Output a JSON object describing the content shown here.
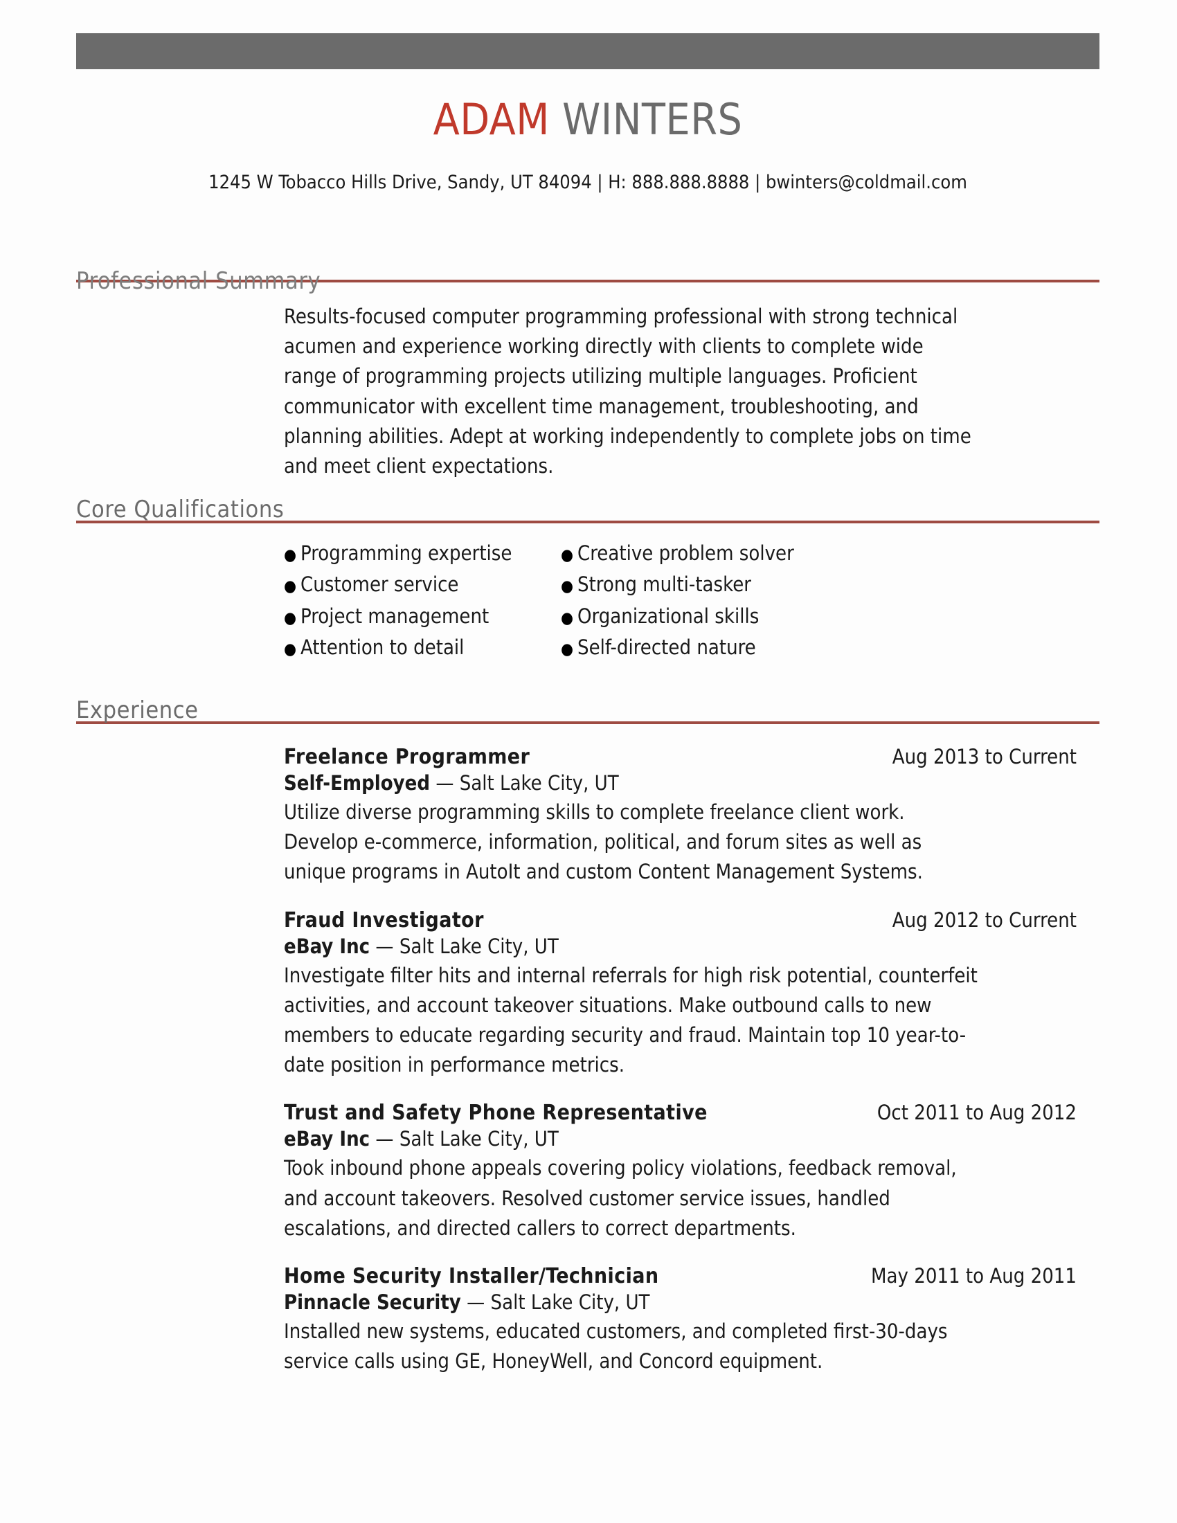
{
  "theme": {
    "accent_red": "#c0392b",
    "rule_red": "#9e4b42",
    "header_gray": "#6b6b6b",
    "text_dark": "#1a1a1a"
  },
  "header": {
    "first_name": "ADAM",
    "last_name": "WINTERS",
    "contact": "1245 W Tobacco Hills Drive, Sandy, UT 84094 | H: 888.888.8888 | bwinters@coldmail.com"
  },
  "sections": {
    "summary": {
      "heading": "Professional Summary",
      "text": "Results-focused computer programming professional with strong technical acumen and experience working directly with clients to complete wide range of programming projects utilizing multiple languages. Proficient communicator with excellent time management, troubleshooting, and planning abilities. Adept at working independently to complete jobs on time and meet client expectations."
    },
    "qualifications": {
      "heading": "Core Qualifications",
      "column_left": [
        "Programming expertise",
        "Customer service",
        "Project management",
        "Attention to detail"
      ],
      "column_right": [
        "Creative problem solver",
        "Strong multi-tasker",
        "Organizational skills",
        "Self-directed nature"
      ],
      "bullet_glyph": "●"
    },
    "experience": {
      "heading": "Experience",
      "separator": "—",
      "jobs": [
        {
          "title": "Freelance Programmer",
          "dates": "Aug 2013 to Current",
          "organization": "Self-Employed",
          "location": "Salt Lake City, UT",
          "description": "Utilize diverse programming skills to complete freelance client work. Develop e-commerce, information, political, and forum sites as well as unique programs in AutoIt and custom Content Management Systems."
        },
        {
          "title": "Fraud Investigator",
          "dates": "Aug 2012 to Current",
          "organization": "eBay Inc",
          "location": "Salt Lake City, UT",
          "description": "Investigate filter hits and internal referrals for high risk potential, counterfeit activities, and account takeover situations. Make outbound calls to new members to educate regarding security and fraud. Maintain top 10 year-to-date position in performance metrics."
        },
        {
          "title": "Trust and Safety Phone Representative",
          "dates": "Oct 2011 to Aug 2012",
          "organization": "eBay Inc",
          "location": "Salt Lake City, UT",
          "description": "Took inbound phone appeals covering policy violations, feedback removal, and account takeovers. Resolved customer service issues, handled escalations, and directed callers to correct departments."
        },
        {
          "title": "Home Security Installer/Technician",
          "dates": "May 2011 to Aug 2011",
          "organization": "Pinnacle Security",
          "location": "Salt Lake City, UT",
          "description": "Installed new systems, educated customers, and completed first-30-days service calls using GE, HoneyWell, and Concord equipment."
        }
      ]
    }
  }
}
